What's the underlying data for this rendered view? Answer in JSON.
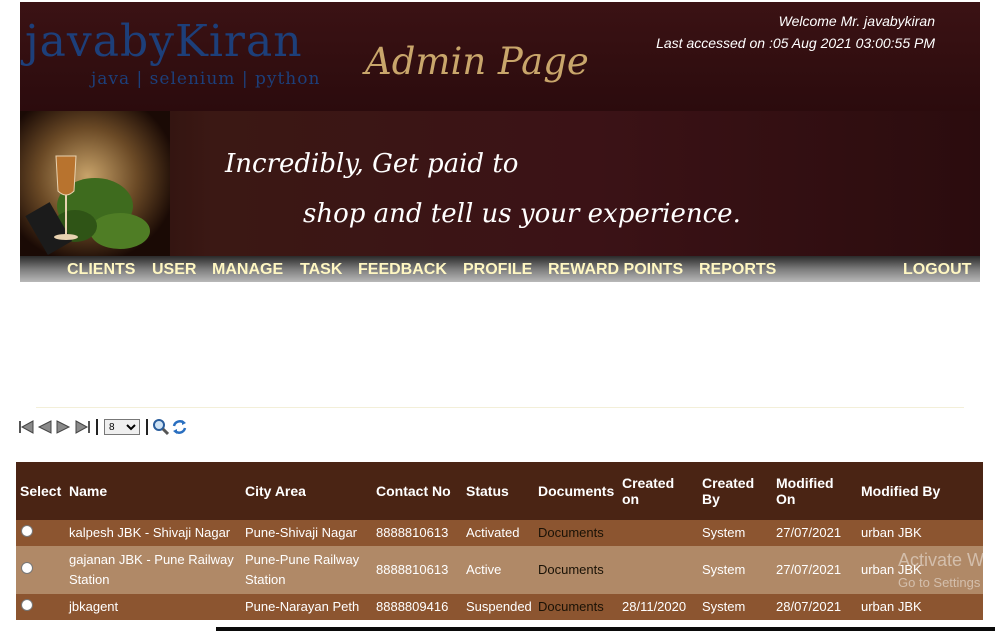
{
  "header": {
    "logo_main": "javabyKiran",
    "logo_sub": "java | selenium | python",
    "admin_title": "Admin Page",
    "welcome": "Welcome Mr. javabykiran",
    "last_accessed": "Last accessed on :05 Aug 2021 03:00:55 PM"
  },
  "banner": {
    "line1": "Incredibly, Get paid to",
    "line2": "shop and tell us your experience."
  },
  "nav": {
    "clients": "CLIENTS",
    "user": "USER",
    "manage": "MANAGE",
    "task": "TASK",
    "feedback": "FEEDBACK",
    "profile": "PROFILE",
    "reward_points": "REWARD POINTS",
    "reports": "REPORTS",
    "logout": "LOGOUT"
  },
  "pager": {
    "page_size": "8"
  },
  "table": {
    "headers": {
      "select": "Select",
      "name": "Name",
      "city": "City Area",
      "contact": "Contact No",
      "status": "Status",
      "documents": "Documents",
      "created_on": "Created on",
      "created_by": "Created By",
      "modified_on": "Modified On",
      "modified_by": "Modified By"
    },
    "rows": [
      {
        "name": "kalpesh JBK - Shivaji Nagar",
        "city": "Pune-Shivaji Nagar",
        "contact": "8888810613",
        "status": "Activated",
        "documents": "Documents",
        "created_on": "",
        "created_by": "System",
        "modified_on": "27/07/2021",
        "modified_by": "urban JBK"
      },
      {
        "name": "gajanan JBK - Pune Railway Station",
        "city": "Pune-Pune Railway Station",
        "contact": "8888810613",
        "status": "Active",
        "documents": "Documents",
        "created_on": "",
        "created_by": "System",
        "modified_on": "27/07/2021",
        "modified_by": "urban JBK"
      },
      {
        "name": "jbkagent",
        "city": "Pune-Narayan Peth",
        "contact": "8888809416",
        "status": "Suspended",
        "documents": "Documents",
        "created_on": "28/11/2020",
        "created_by": "System",
        "modified_on": "28/07/2021",
        "modified_by": "urban JBK"
      }
    ]
  },
  "watermark": {
    "line1": "Activate Wi",
    "line2": "Go to Settings"
  },
  "colors": {
    "header_bg": "#2b0b0d",
    "nav_text": "#fff7c2",
    "table_header": "#4a2414",
    "row_dark": "#8c5530",
    "row_light": "#b08967"
  }
}
